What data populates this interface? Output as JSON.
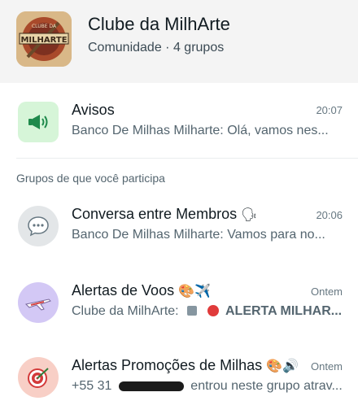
{
  "community": {
    "name": "Clube da MilhArte",
    "subtitle": "Comunidade · 4 grupos",
    "logo_text": "MILHARTE",
    "logo_small": "CLUBE DA"
  },
  "announcements": {
    "title": "Avisos",
    "time": "20:07",
    "message": "Banco De Milhas Milharte: Olá, vamos nes..."
  },
  "section_label": "Grupos de que você participa",
  "groups": [
    {
      "title": "Conversa entre Membros",
      "emoji": "🗣",
      "time": "20:06",
      "message": "Banco De Milhas Milharte: Vamos para no..."
    },
    {
      "title": "Alertas de Voos",
      "emoji": "🎨✈️",
      "time": "Ontem",
      "sender": "Clube da MilhArte:",
      "message_bold": "ALERTA MILHAR..."
    },
    {
      "title": "Alertas Promoções de Milhas",
      "emoji": "🎨🔊",
      "time": "Ontem",
      "message_prefix": "+55 31",
      "message_suffix": "entrou neste grupo atrav..."
    }
  ]
}
